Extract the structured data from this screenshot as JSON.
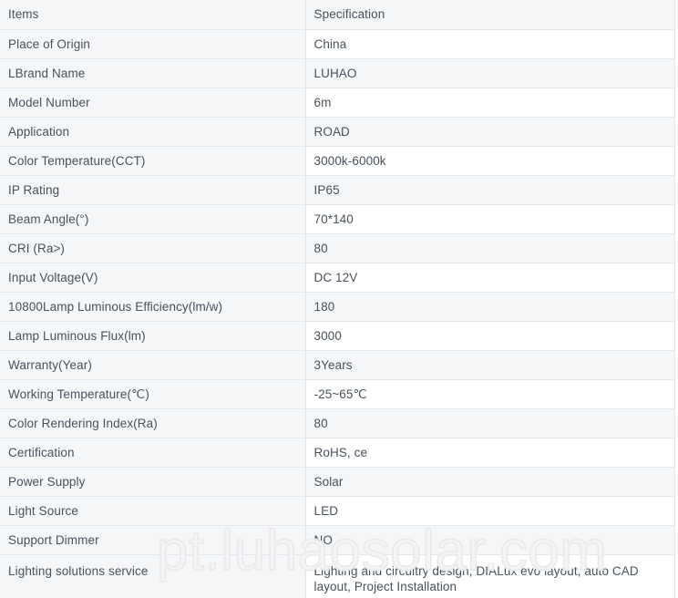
{
  "watermark": {
    "text": "pt.luhaosolar.com",
    "color": "#e6e8ea"
  },
  "table": {
    "columns": [
      "Items",
      "Specification"
    ],
    "header": {
      "label": "Items",
      "value": "Specification"
    },
    "rows": [
      {
        "label": "Place of Origin",
        "value": "China"
      },
      {
        "label": "LBrand Name",
        "value": "LUHAO"
      },
      {
        "label": "Model Number",
        "value": "6m"
      },
      {
        "label": "Application",
        "value": "ROAD"
      },
      {
        "label": "Color Temperature(CCT)",
        "value": "3000k-6000k"
      },
      {
        "label": "IP Rating",
        "value": "IP65"
      },
      {
        "label": "Beam Angle(°)",
        "value": "70*140"
      },
      {
        "label": "CRI (Ra>)",
        "value": "80"
      },
      {
        "label": "Input Voltage(V)",
        "value": "DC 12V"
      },
      {
        "label": "10800Lamp Luminous Efficiency(lm/w)",
        "value": "180"
      },
      {
        "label": "Lamp Luminous Flux(lm)",
        "value": "3000"
      },
      {
        "label": "Warranty(Year)",
        "value": "3Years"
      },
      {
        "label": "Working Temperature(℃)",
        "value": "-25~65℃"
      },
      {
        "label": "Color Rendering Index(Ra)",
        "value": "80"
      },
      {
        "label": "Certification",
        "value": "RoHS, ce"
      },
      {
        "label": "Power Supply",
        "value": "Solar"
      },
      {
        "label": "Light Source",
        "value": "LED"
      },
      {
        "label": "Support Dimmer",
        "value": "NO"
      },
      {
        "label": "Lighting solutions service",
        "value": "Lighting and circuitry design, DIALux evo layout, auto CAD layout, Project Installation"
      }
    ]
  }
}
